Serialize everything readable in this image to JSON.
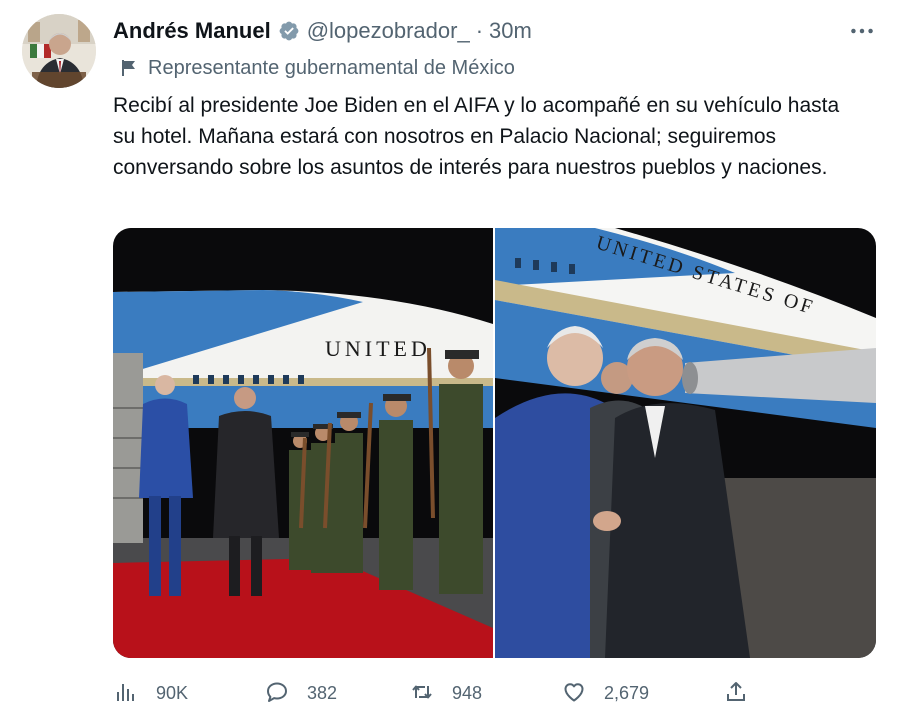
{
  "author": {
    "display_name": "Andrés Manuel",
    "handle": "@lopezobrador_",
    "separator": "·",
    "time": "30m",
    "label": "Representante gubernamental de México"
  },
  "tweet": {
    "text": "Recibí al presidente Joe Biden en el AIFA y lo acompañé en su vehículo hasta su hotel. Mañana estará con nosotros en Palacio Nacional; seguiremos conversando sobre los asuntos de interés para nuestros pueblos y naciones."
  },
  "media": {
    "left_fuselage_text": "UNITED",
    "right_fuselage_text": "UNITED STATES OF"
  },
  "metrics": {
    "views": "90K",
    "replies": "382",
    "retweets": "948",
    "likes": "2,679"
  },
  "colors": {
    "verified": "#829aab",
    "text_secondary": "#536471",
    "carpet": "#b8111a",
    "sky": "#0a0a0c",
    "plane_blue": "#3a7cc0"
  },
  "icons": {
    "verified": "verified-badge-icon",
    "more": "more-dots-icon",
    "label": "flag-icon",
    "views": "views-chart-icon",
    "reply": "reply-bubble-icon",
    "retweet": "retweet-icon",
    "like": "heart-icon",
    "share": "share-icon"
  }
}
